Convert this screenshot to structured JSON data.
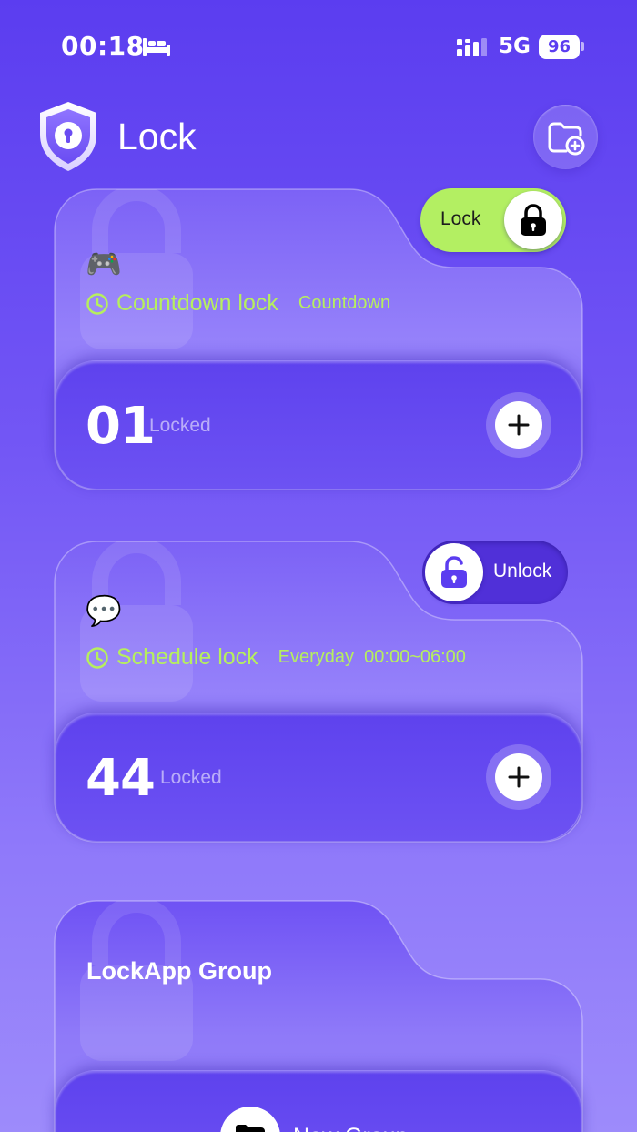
{
  "status_bar": {
    "time": "00:18",
    "network": "5G",
    "battery": "96"
  },
  "header": {
    "title": "Lock"
  },
  "cards": [
    {
      "toggle_label": "Lock",
      "toggle_state": "locked",
      "lock_type": "Countdown lock",
      "detail": "Countdown",
      "count": "01",
      "count_label": "Locked"
    },
    {
      "toggle_label": "Unlock",
      "toggle_state": "unlocked",
      "lock_type": "Schedule lock",
      "detail": "Everyday  00:00~06:00",
      "count": "44",
      "count_label": "Locked"
    }
  ],
  "group": {
    "title": "LockApp Group",
    "new_group_label": "New Group"
  },
  "colors": {
    "accent_green": "#b3ef62",
    "primary_purple": "#5b3df0"
  }
}
